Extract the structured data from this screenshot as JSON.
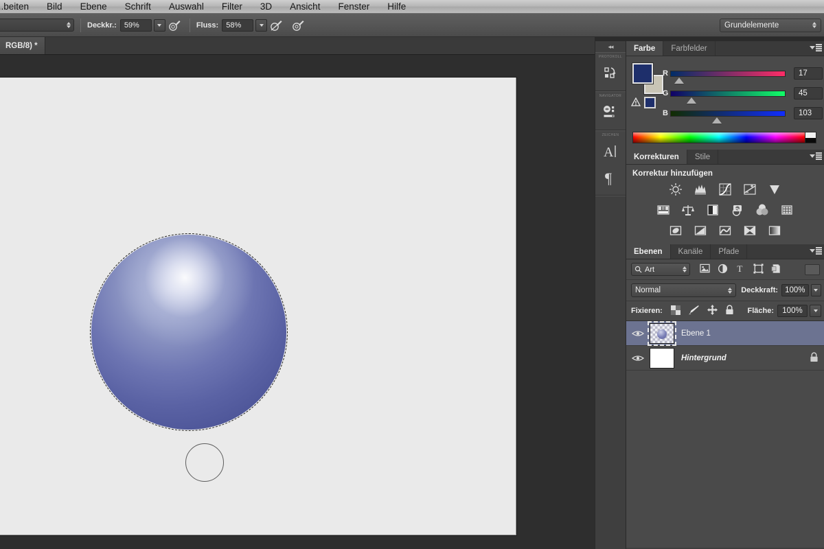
{
  "menubar": {
    "items": [
      {
        "label": "...beiten"
      },
      {
        "label": "Bild"
      },
      {
        "label": "Ebene"
      },
      {
        "label": "Schrift"
      },
      {
        "label": "Auswahl"
      },
      {
        "label": "Filter"
      },
      {
        "label": "3D"
      },
      {
        "label": "Ansicht"
      },
      {
        "label": "Fenster"
      },
      {
        "label": "Hilfe"
      }
    ]
  },
  "options_bar": {
    "opacity_label": "Deckkr.:",
    "opacity_value": "59%",
    "flow_label": "Fluss:",
    "flow_value": "58%",
    "workspace": "Grundelemente"
  },
  "document": {
    "tab_title": "RGB/8) *"
  },
  "icon_dock": {
    "collapse_label": "◂◂",
    "groups": [
      {
        "caption": "PROTOKOLL",
        "icon": "history-icon"
      },
      {
        "caption": "NAVIGATOR",
        "icon": "navigator-icon"
      },
      {
        "caption": "ZEICHEN",
        "icon": "character-icon"
      }
    ],
    "paragraph_icon": "paragraph-icon"
  },
  "color_panel": {
    "tabs": [
      {
        "label": "Farbe",
        "active": true
      },
      {
        "label": "Farbfelder",
        "active": false
      }
    ],
    "foreground_color": "#1e2f6b",
    "background_color": "#c9c5b6",
    "channels": [
      {
        "label": "R",
        "value": "17",
        "thumb_pct": 7
      },
      {
        "label": "G",
        "value": "45",
        "thumb_pct": 18
      },
      {
        "label": "B",
        "value": "103",
        "thumb_pct": 40
      }
    ]
  },
  "adjustments_panel": {
    "tabs": [
      {
        "label": "Korrekturen",
        "active": true
      },
      {
        "label": "Stile",
        "active": false
      }
    ],
    "title": "Korrektur hinzufügen",
    "rows": [
      [
        "brightness-contrast-icon",
        "levels-icon",
        "curves-icon",
        "exposure-icon",
        "vibrance-icon"
      ],
      [
        "hue-saturation-icon",
        "color-balance-icon",
        "black-white-icon",
        "photo-filter-icon",
        "channel-mixer-icon",
        "color-lookup-icon"
      ],
      [
        "invert-icon",
        "posterize-icon",
        "threshold-icon",
        "selective-color-icon",
        "gradient-map-icon"
      ]
    ]
  },
  "layers_panel": {
    "tabs": [
      {
        "label": "Ebenen",
        "active": true
      },
      {
        "label": "Kanäle",
        "active": false
      },
      {
        "label": "Pfade",
        "active": false
      }
    ],
    "filter": {
      "kind_label": "Art",
      "icons": [
        "pixel-filter-icon",
        "adjustment-filter-icon",
        "type-filter-icon",
        "shape-filter-icon",
        "smartobject-filter-icon"
      ]
    },
    "blend_mode": "Normal",
    "opacity_label": "Deckkraft:",
    "opacity_value": "100%",
    "lock_label": "Fixieren:",
    "lock_icons": [
      "lock-transparency-icon",
      "lock-image-icon",
      "lock-position-icon",
      "lock-all-icon"
    ],
    "fill_label": "Fläche:",
    "fill_value": "100%",
    "layers": [
      {
        "name": "Ebene 1",
        "visible": true,
        "selected": true,
        "locked": false,
        "thumb": "transparent-sphere"
      },
      {
        "name": "Hintergrund",
        "visible": true,
        "selected": false,
        "locked": true,
        "thumb": "white"
      }
    ]
  },
  "canvas": {
    "background_color": "#eaeaea",
    "sphere_selection": "marching-ants",
    "brush_cursor": "circle"
  }
}
